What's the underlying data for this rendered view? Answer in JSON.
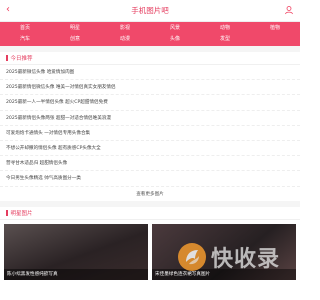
{
  "header": {
    "title": "手机图片吧"
  },
  "nav": {
    "items": [
      "首页",
      "明星",
      "影视",
      "风景",
      "动物",
      "植物",
      "汽车",
      "创意",
      "动漫",
      "头像",
      "发型"
    ]
  },
  "today": {
    "title": "今日推荐",
    "items": [
      "2025最新微信头像 哈爱情加肉图",
      "2025最新情侣微信头像 唯美一对情侣真实女朋友情侣",
      "2025最新一人一半情侣头像 超火CP超甜情侣免费",
      "2025最新情侣头像两张 超甜一对适合情侣唯美浪漫",
      "可爱炮炮卡通情头 一对情侣专用头像合集",
      "不想公开却撒的情侣头像 超有质感CP头像大全",
      "营寻甘木适品归 超甜情侣头像",
      "今日男生头像精选 帅气高质图分一类"
    ],
    "more_label": "查看更多图片"
  },
  "stars": {
    "title": "明星图片",
    "items": [
      {
        "caption": "陈小纭黑发性感纯欲写真"
      },
      {
        "caption": "宋佳墨绿色连衣裙写真图片"
      }
    ]
  },
  "watermark": {
    "text": "快收录"
  },
  "colors": {
    "accent": "#f0496a",
    "title": "#e53d5f"
  }
}
